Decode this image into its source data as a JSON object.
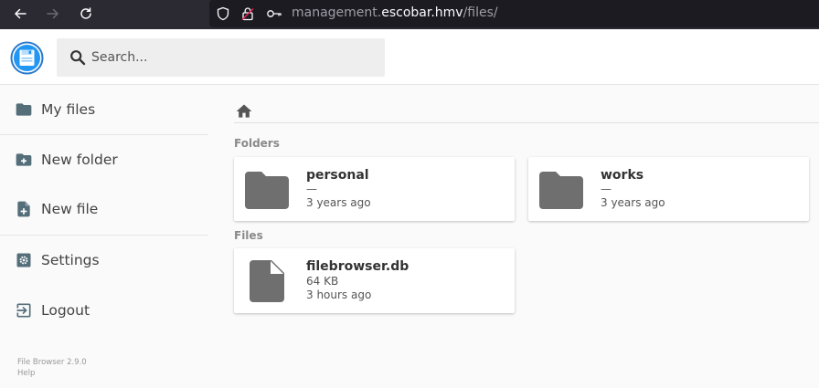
{
  "browser": {
    "url_prefix": "management.",
    "url_host": "escobar.hmv",
    "url_path": "/files/"
  },
  "header": {
    "search_placeholder": "Search..."
  },
  "sidebar": {
    "items": [
      {
        "label": "My files",
        "icon": "folder-icon"
      },
      {
        "label": "New folder",
        "icon": "new-folder-icon"
      },
      {
        "label": "New file",
        "icon": "new-file-icon"
      },
      {
        "label": "Settings",
        "icon": "settings-icon"
      },
      {
        "label": "Logout",
        "icon": "logout-icon"
      }
    ],
    "version": "File Browser 2.9.0",
    "help": "Help"
  },
  "main": {
    "folders_title": "Folders",
    "files_title": "Files",
    "folders": [
      {
        "name": "personal",
        "size": "—",
        "modified": "3 years ago"
      },
      {
        "name": "works",
        "size": "—",
        "modified": "3 years ago"
      }
    ],
    "files": [
      {
        "name": "filebrowser.db",
        "size": "64 KB",
        "modified": "3 hours ago"
      }
    ]
  },
  "colors": {
    "accent": "#2196f3",
    "icon_gray": "#546e7a",
    "chrome_bg": "#2b2a33"
  }
}
